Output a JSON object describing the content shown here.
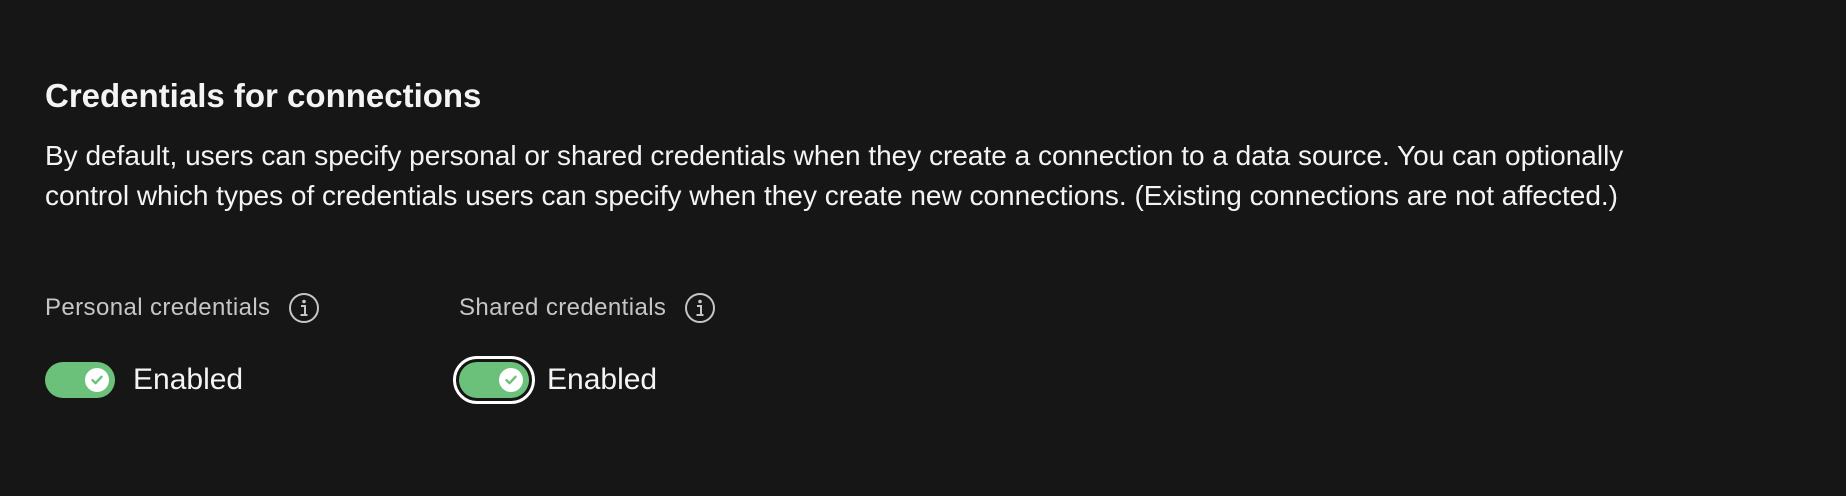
{
  "section": {
    "title": "Credentials for connections",
    "description": "By default, users can specify personal or shared credentials when they create a connection to a data source. You can optionally control which types of credentials users can specify when they create new connections. (Existing connections are not affected.)"
  },
  "settings": [
    {
      "label": "Personal credentials",
      "info_icon": "info-icon",
      "toggle_on": true,
      "state_text": "Enabled"
    },
    {
      "label": "Shared credentials",
      "info_icon": "info-icon",
      "toggle_on": true,
      "focused": true,
      "state_text": "Enabled"
    }
  ],
  "colors": {
    "background": "#161616",
    "text_primary": "#f4f4f4",
    "text_secondary": "#c6c6c6",
    "toggle_on": "#6cc17a",
    "focus_ring": "#ffffff"
  }
}
